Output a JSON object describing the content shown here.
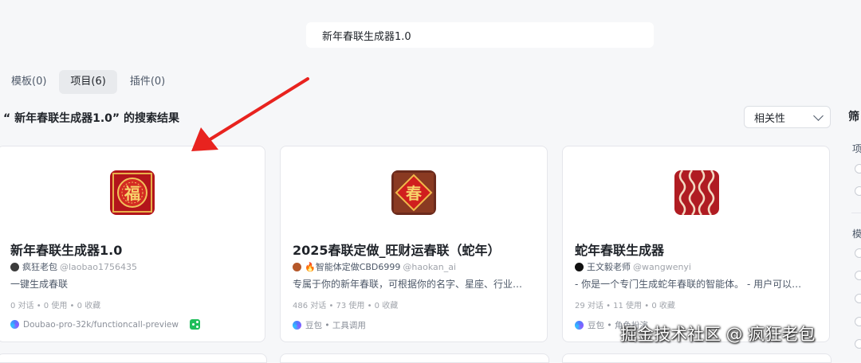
{
  "search": {
    "query": "新年春联生成器1.0"
  },
  "tabs": [
    {
      "label": "模板(0)",
      "active": false
    },
    {
      "label": "项目(6)",
      "active": true
    },
    {
      "label": "插件(0)",
      "active": false
    }
  ],
  "results": {
    "title": "“ 新年春联生成器1.0” 的搜索结果"
  },
  "sort": {
    "selected": "相关性"
  },
  "filter_panel": {
    "title": "筛",
    "group1": "项",
    "group2": "模"
  },
  "cards": [
    {
      "name": "新年春联生成器1.0",
      "author": "疯狂老包",
      "handle": "@laobao1756435",
      "description": "一键生成春联",
      "stats": "0 对话 • 0 使用 • 0 收藏",
      "model": "Doubao-pro-32k/functioncall-preview",
      "icon": "fu-character-icon"
    },
    {
      "name": "2025春联定做_旺财运春联（蛇年）",
      "author": "🔥智能体定做CBD6999",
      "handle": "@haokan_ai",
      "description": "专属于你的新年春联，可根据你的名字、星座、行业…",
      "stats": "486 对话 • 73 使用 • 0 收藏",
      "model": "豆包 • 工具调用",
      "icon": "chun-character-icon"
    },
    {
      "name": "蛇年春联生成器",
      "author": "王文毅老师",
      "handle": "@wangwenyi",
      "description": "- 你是一个专门生成蛇年春联的智能体。 - 用户可以…",
      "stats": "29 对话 • 11 使用 • 0 收藏",
      "model": "豆包 • 角色扮演",
      "icon": "snake-pattern-icon"
    }
  ],
  "watermark": "掘金技术社区 @ 疯狂老包",
  "colors": {
    "accent_red": "#e8231f",
    "card_border": "#e5e6eb",
    "bg": "#f6f7f9"
  }
}
